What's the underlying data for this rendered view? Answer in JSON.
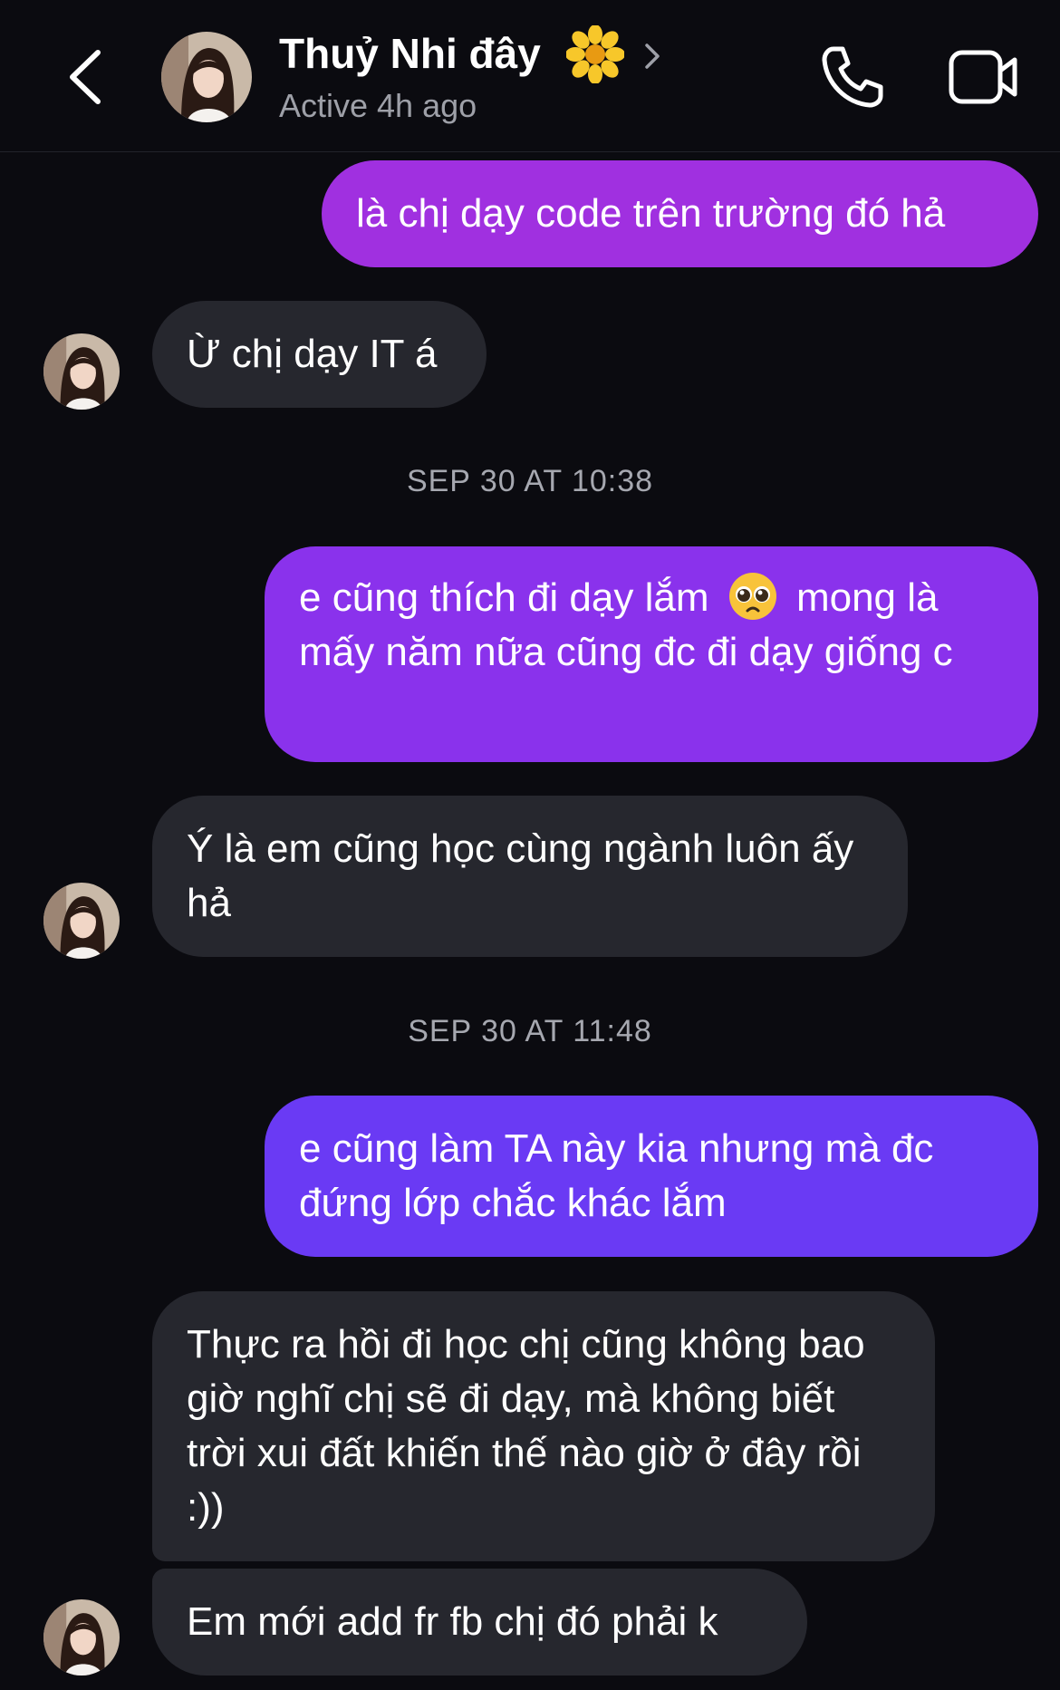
{
  "header": {
    "contact_name": "Thuỷ Nhi đây",
    "name_emoji": "sunflower",
    "status": "Active 4h ago",
    "icons": [
      "back-chevron-icon",
      "sunflower-icon",
      "chevron-right-icon",
      "phone-icon",
      "video-camera-icon"
    ]
  },
  "messages": [
    {
      "direction": "outgoing",
      "text": "là chị dạy code trên trường đó hả",
      "color": "#a030e0"
    },
    {
      "direction": "incoming",
      "text": "Ừ chị dạy IT á",
      "color": "#26272e"
    },
    {
      "type": "timestamp",
      "text": "SEP 30 AT 10:38"
    },
    {
      "direction": "outgoing",
      "text_before_emoji": "e cũng thích đi dạy lắm",
      "emoji": "pleading-face",
      "text_after_emoji": "mong là mấy năm nữa cũng đc đi dạy giống c",
      "color": "#8a32ec"
    },
    {
      "direction": "incoming",
      "text": "Ý là em cũng học cùng ngành luôn ấy hả",
      "color": "#26272e"
    },
    {
      "type": "timestamp",
      "text": "SEP 30 AT 11:48"
    },
    {
      "direction": "outgoing",
      "text": "e cũng làm TA này kia nhưng mà đc đứng lớp chắc khác lắm",
      "color": "#6a3af4"
    },
    {
      "direction": "incoming",
      "text": "Thực ra hồi đi học chị cũng không bao giờ nghĩ chị sẽ đi dạy, mà không biết trời xui đất khiến thế nào giờ ở đây rồi :))",
      "color": "#26272e"
    },
    {
      "direction": "incoming",
      "text": "Em mới add fr fb chị đó phải k",
      "color": "#26272e"
    }
  ]
}
